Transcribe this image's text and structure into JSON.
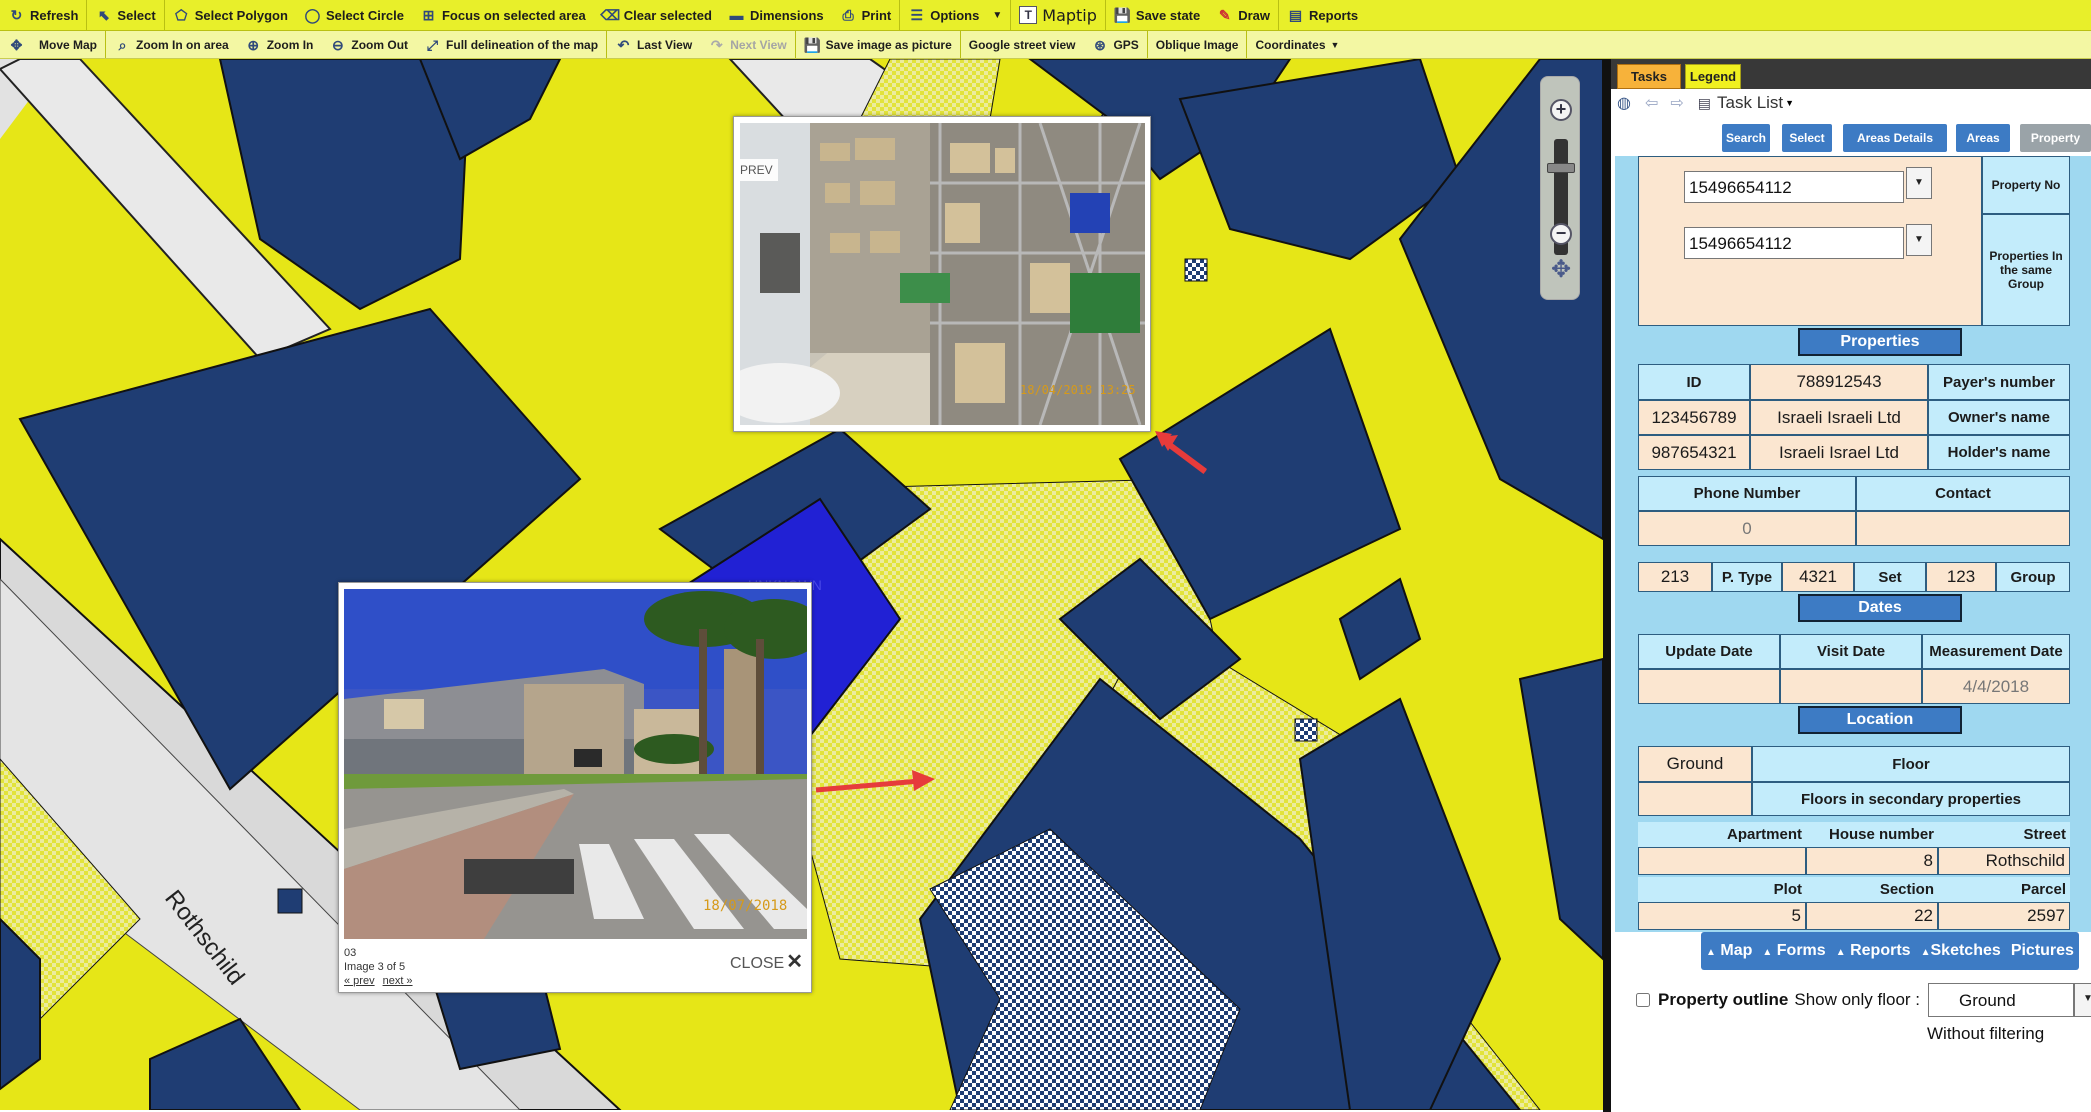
{
  "toolbar1": {
    "refresh": "Refresh",
    "select": "Select",
    "select_polygon": "Select Polygon",
    "select_circle": "Select Circle",
    "focus": "Focus on selected area",
    "clear": "Clear selected",
    "dimensions": "Dimensions",
    "print": "Print",
    "options": "Options",
    "maptip": "Maptip",
    "save_state": "Save state",
    "draw": "Draw",
    "reports": "Reports"
  },
  "toolbar2": {
    "move_map": "Move Map",
    "zoom_area": "Zoom In on area",
    "zoom_in": "Zoom In",
    "zoom_out": "Zoom Out",
    "full_delineation": "Full delineation of the map",
    "last_view": "Last View",
    "next_view": "Next View",
    "save_image": "Save image as picture",
    "street_view": "Google street view",
    "gps": "GPS",
    "oblique": "Oblique Image",
    "coordinates": "Coordinates"
  },
  "map": {
    "street_label": "Rothschild",
    "highlight_label": "UNKNOWN"
  },
  "photo_top": {
    "prev": "PREV",
    "stamp": "18/04/2018 13:25"
  },
  "photo_bottom": {
    "number": "03",
    "count": "Image 3 of 5",
    "prev": "« prev",
    "next": "next »",
    "close": "CLOSE",
    "stamp": "18/07/2018"
  },
  "panel": {
    "tabs": {
      "tasks": "Tasks",
      "legend": "Legend"
    },
    "task_list": "Task List",
    "nav": [
      "Search",
      "Select",
      "Areas Details",
      "Areas",
      "Property"
    ],
    "property_no_label": "Property No",
    "property_no_value": "15496654112",
    "same_group_label": "Properties In the same Group",
    "same_group_value": "15496654112",
    "properties_head": "Properties",
    "id_label": "ID",
    "payer_number_value": "788912543",
    "payer_number_label": "Payer's number",
    "owner_id": "123456789",
    "owner_name_value": "Israeli Israeli Ltd",
    "owner_name_label": "Owner's name",
    "holder_id": "987654321",
    "holder_name_value": "Israeli Israel Ltd",
    "holder_name_label": "Holder's name",
    "phone_label": "Phone Number",
    "contact_label": "Contact",
    "phone_value": "0",
    "contact_value": "",
    "ptype_value": "213",
    "ptype_label": "P. Type",
    "set_value": "4321",
    "set_label": "Set",
    "group_value": "123",
    "group_label": "Group",
    "dates_head": "Dates",
    "update_date_label": "Update Date",
    "visit_date_label": "Visit Date",
    "measurement_date_label": "Measurement Date",
    "update_date_value": "",
    "visit_date_value": "",
    "measurement_date_value": "4/4/2018",
    "location_head": "Location",
    "ground_value": "Ground",
    "floor_label": "Floor",
    "secondary_value": "",
    "secondary_label": "Floors in secondary properties",
    "apartment_label": "Apartment",
    "house_number_label": "House number",
    "street_label": "Street",
    "apartment_value": "",
    "house_number_value": "8",
    "street_value": "Rothschild",
    "plot_label": "Plot",
    "section_label": "Section",
    "parcel_label": "Parcel",
    "plot_value": "5",
    "section_value": "22",
    "parcel_value": "2597",
    "bottom_tabs": [
      "Map",
      "Forms",
      "Reports",
      "Sketches",
      "Pictures"
    ],
    "outline_label": "Property outline",
    "show_floor_label": "Show only floor :",
    "floor_select_value": "Ground",
    "without_filtering": "Without filtering"
  },
  "colors": {
    "toolbar": "#e8ef2a",
    "parcel_blue": "#1f3d73",
    "parcel_yellow": "#e6e617",
    "highlight": "#2121d4",
    "panel_bg": "#9fd8f0",
    "button_blue": "#3d7bc4",
    "cell_value": "#fbe6d0"
  },
  "icons": [
    "refresh-icon",
    "cursor-icon",
    "polygon-icon",
    "circle-icon",
    "focus-icon",
    "eraser-icon",
    "ruler-icon",
    "printer-icon",
    "options-icon",
    "maptip-icon",
    "save-icon",
    "draw-icon",
    "reports-icon",
    "move-icon",
    "zoom-area-icon",
    "zoom-in-icon",
    "zoom-out-icon",
    "full-extent-icon",
    "last-view-icon",
    "next-view-icon",
    "camera-icon",
    "gps-icon"
  ]
}
